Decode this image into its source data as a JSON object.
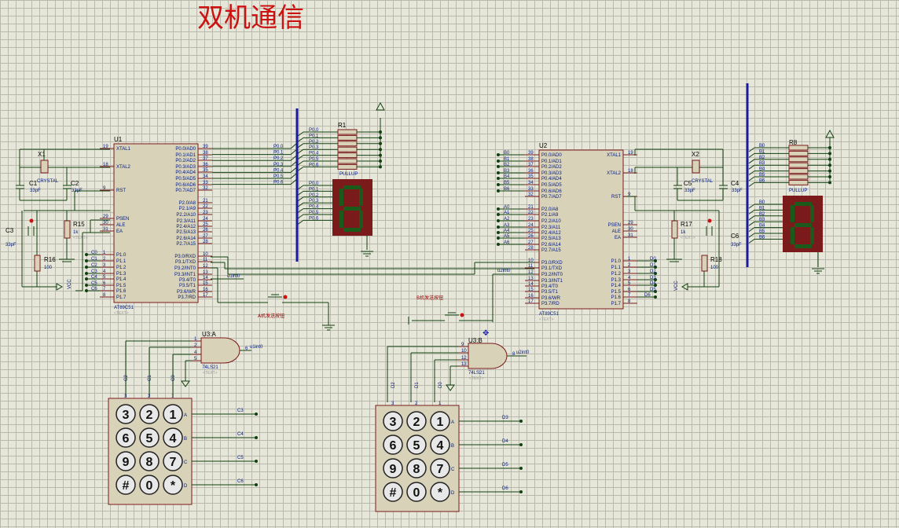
{
  "title": "双机通信",
  "colors": {
    "wire": "#104010",
    "bus": "#1a1aa0",
    "chip": "#d8d2b8",
    "title": "#cc1111",
    "seg_bg": "#7a1a1a",
    "seg_on": "#1a5a1a"
  },
  "u1": {
    "ref": "U1",
    "part": "AT89C51",
    "text": "<TEXT>",
    "left_pins": [
      {
        "num": "19",
        "name": "XTAL1"
      },
      {
        "num": "18",
        "name": "XTAL2"
      },
      {
        "num": "9",
        "name": "RST"
      },
      {
        "num": "29",
        "name": "PSEN"
      },
      {
        "num": "30",
        "name": "ALE"
      },
      {
        "num": "31",
        "name": "EA"
      },
      {
        "num": "1",
        "name": "P1.0"
      },
      {
        "num": "2",
        "name": "P1.1"
      },
      {
        "num": "3",
        "name": "P1.2"
      },
      {
        "num": "4",
        "name": "P1.3"
      },
      {
        "num": "5",
        "name": "P1.4"
      },
      {
        "num": "6",
        "name": "P1.5"
      },
      {
        "num": "7",
        "name": "P1.6"
      },
      {
        "num": "8",
        "name": "P1.7"
      }
    ],
    "right_pins": [
      {
        "num": "39",
        "name": "P0.0/AD0"
      },
      {
        "num": "38",
        "name": "P0.1/AD1"
      },
      {
        "num": "37",
        "name": "P0.2/AD2"
      },
      {
        "num": "36",
        "name": "P0.3/AD3"
      },
      {
        "num": "35",
        "name": "P0.4/AD4"
      },
      {
        "num": "34",
        "name": "P0.5/AD5"
      },
      {
        "num": "33",
        "name": "P0.6/AD6"
      },
      {
        "num": "32",
        "name": "P0.7/AD7"
      },
      {
        "num": "21",
        "name": "P2.0/A8"
      },
      {
        "num": "22",
        "name": "P2.1/A9"
      },
      {
        "num": "23",
        "name": "P2.2/A10"
      },
      {
        "num": "24",
        "name": "P2.3/A11"
      },
      {
        "num": "25",
        "name": "P2.4/A12"
      },
      {
        "num": "26",
        "name": "P2.5/A13"
      },
      {
        "num": "27",
        "name": "P2.6/A14"
      },
      {
        "num": "28",
        "name": "P2.7/A15"
      },
      {
        "num": "10",
        "name": "P3.0/RXD"
      },
      {
        "num": "11",
        "name": "P3.1/TXD"
      },
      {
        "num": "12",
        "name": "P3.2/INT0"
      },
      {
        "num": "13",
        "name": "P3.3/INT1"
      },
      {
        "num": "14",
        "name": "P3.4/T0"
      },
      {
        "num": "15",
        "name": "P3.5/T1"
      },
      {
        "num": "16",
        "name": "P3.6/WR"
      },
      {
        "num": "17",
        "name": "P3.7/RD"
      }
    ]
  },
  "u2": {
    "ref": "U2",
    "part": "AT89C51",
    "text": "<TEXT>",
    "left_pins": [
      {
        "num": "39",
        "name": "P0.0/AD0"
      },
      {
        "num": "38",
        "name": "P0.1/AD1"
      },
      {
        "num": "37",
        "name": "P0.2/AD2"
      },
      {
        "num": "36",
        "name": "P0.3/AD3"
      },
      {
        "num": "35",
        "name": "P0.4/AD4"
      },
      {
        "num": "34",
        "name": "P0.5/AD5"
      },
      {
        "num": "33",
        "name": "P0.6/AD6"
      },
      {
        "num": "32",
        "name": "P0.7/AD7"
      },
      {
        "num": "21",
        "name": "P2.0/A8"
      },
      {
        "num": "22",
        "name": "P2.1/A9"
      },
      {
        "num": "23",
        "name": "P2.2/A10"
      },
      {
        "num": "24",
        "name": "P2.3/A11"
      },
      {
        "num": "25",
        "name": "P2.4/A12"
      },
      {
        "num": "26",
        "name": "P2.5/A13"
      },
      {
        "num": "27",
        "name": "P2.6/A14"
      },
      {
        "num": "28",
        "name": "P2.7/A15"
      },
      {
        "num": "10",
        "name": "P3.0/RXD"
      },
      {
        "num": "11",
        "name": "P3.1/TXD"
      },
      {
        "num": "12",
        "name": "P3.2/INT0"
      },
      {
        "num": "13",
        "name": "P3.3/INT1"
      },
      {
        "num": "14",
        "name": "P3.4/T0"
      },
      {
        "num": "15",
        "name": "P3.5/T1"
      },
      {
        "num": "16",
        "name": "P3.6/WR"
      },
      {
        "num": "17",
        "name": "P3.7/RD"
      }
    ],
    "right_pins": [
      {
        "num": "19",
        "name": "XTAL1"
      },
      {
        "num": "18",
        "name": "XTAL2"
      },
      {
        "num": "9",
        "name": "RST"
      },
      {
        "num": "29",
        "name": "PSEN"
      },
      {
        "num": "30",
        "name": "ALE"
      },
      {
        "num": "31",
        "name": "EA"
      },
      {
        "num": "1",
        "name": "P1.0"
      },
      {
        "num": "2",
        "name": "P1.1"
      },
      {
        "num": "3",
        "name": "P1.2"
      },
      {
        "num": "4",
        "name": "P1.3"
      },
      {
        "num": "5",
        "name": "P1.4"
      },
      {
        "num": "6",
        "name": "P1.5"
      },
      {
        "num": "7",
        "name": "P1.6"
      },
      {
        "num": "8",
        "name": "P1.7"
      }
    ]
  },
  "nets_p0": [
    "P0.0",
    "P0.1",
    "P0.2",
    "P0.3",
    "P0.4",
    "P0.5",
    "P0.6"
  ],
  "nets_b": [
    "B0",
    "B1",
    "B2",
    "B3",
    "B4",
    "B5",
    "B6"
  ],
  "nets_a": [
    "A0",
    "A1",
    "A2",
    "A3",
    "A4",
    "A5",
    "A6"
  ],
  "nets_c": [
    "C0",
    "C1",
    "C2",
    "C3",
    "C4",
    "C5",
    "C6"
  ],
  "nets_d": [
    "D0",
    "D1",
    "D2",
    "D3",
    "D4",
    "D5",
    "D6"
  ],
  "parts": {
    "r1": "R1",
    "r8": "R8",
    "pullup": "PULLUP",
    "x1": "X1",
    "x2": "X2",
    "crystal": "CRYSTAL",
    "c1": "C1",
    "c2": "C2",
    "c3": "C3",
    "c4": "C4",
    "c5": "C5",
    "c6": "C6",
    "c33": "33pF",
    "c33b": "33pF",
    "r15": "R15",
    "r16": "R16",
    "r17": "R17",
    "r18": "R18",
    "r1k": "1k",
    "r100": "100",
    "u3a": "U3:A",
    "u3b": "U3:B",
    "ls21": "74LS21",
    "text": "<TEXT>",
    "vcc": "VCC",
    "btn_a": "A机发送按钮",
    "btn_b": "B机发送按钮",
    "u1int0": "u1int0",
    "u2int0": "u2int0"
  },
  "keypad_keys": [
    "3",
    "2",
    "1",
    "6",
    "5",
    "4",
    "9",
    "8",
    "7",
    "#",
    "0",
    "*"
  ],
  "keypad_cols": [
    "3",
    "2",
    "1"
  ],
  "keypad_rows": [
    "A",
    "B",
    "C",
    "D"
  ],
  "kp1_nets": [
    "C3",
    "C4",
    "C5",
    "C6"
  ],
  "kp2_nets": [
    "D3",
    "D4",
    "D5",
    "D6"
  ],
  "kp1_top": [
    "C2",
    "C1",
    "C0"
  ],
  "kp2_top": [
    "D2",
    "D1",
    "D0"
  ],
  "gate_a_pins": [
    "1",
    "2",
    "4",
    "5",
    "6"
  ],
  "gate_b_pins": [
    "9",
    "10",
    "12",
    "13",
    "8"
  ],
  "seg_digit": "8"
}
